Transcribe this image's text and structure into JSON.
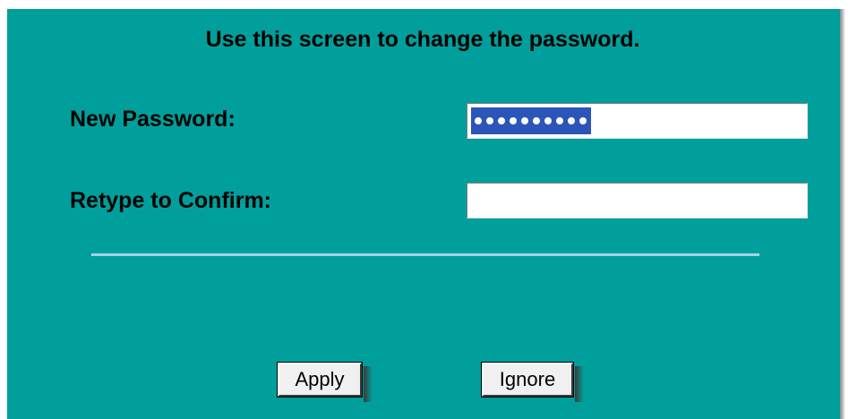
{
  "screen": {
    "title": "Use this screen to change the password."
  },
  "form": {
    "new_password": {
      "label": "New Password:",
      "masked_length": 10
    },
    "confirm_password": {
      "label": "Retype to Confirm:",
      "value": ""
    }
  },
  "buttons": {
    "apply_label": "Apply",
    "ignore_label": "Ignore"
  },
  "colors": {
    "panel_background": "#009f9b",
    "selection_highlight": "#2c55b8",
    "divider": "#a7d3e6"
  }
}
